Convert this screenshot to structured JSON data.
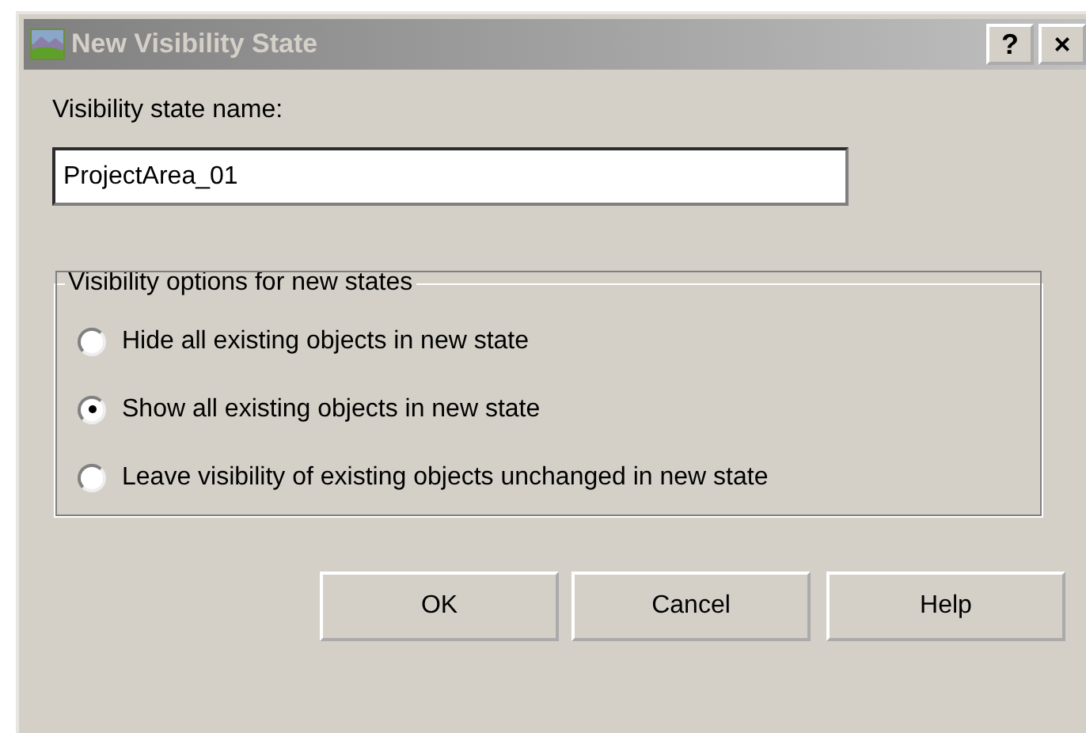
{
  "window": {
    "title": "New Visibility State",
    "title_buttons": [
      "?",
      "×"
    ]
  },
  "name_field": {
    "label": "Visibility state name:",
    "value": "ProjectArea_01"
  },
  "options": {
    "title": "Visibility options for new states",
    "items": [
      {
        "label": "Hide all existing objects in new state",
        "selected": false
      },
      {
        "label": "Show all existing objects in new state",
        "selected": true
      },
      {
        "label": "Leave visibility of existing objects unchanged in new state",
        "selected": false
      }
    ]
  },
  "buttons": [
    "OK",
    "Cancel",
    "Help"
  ]
}
